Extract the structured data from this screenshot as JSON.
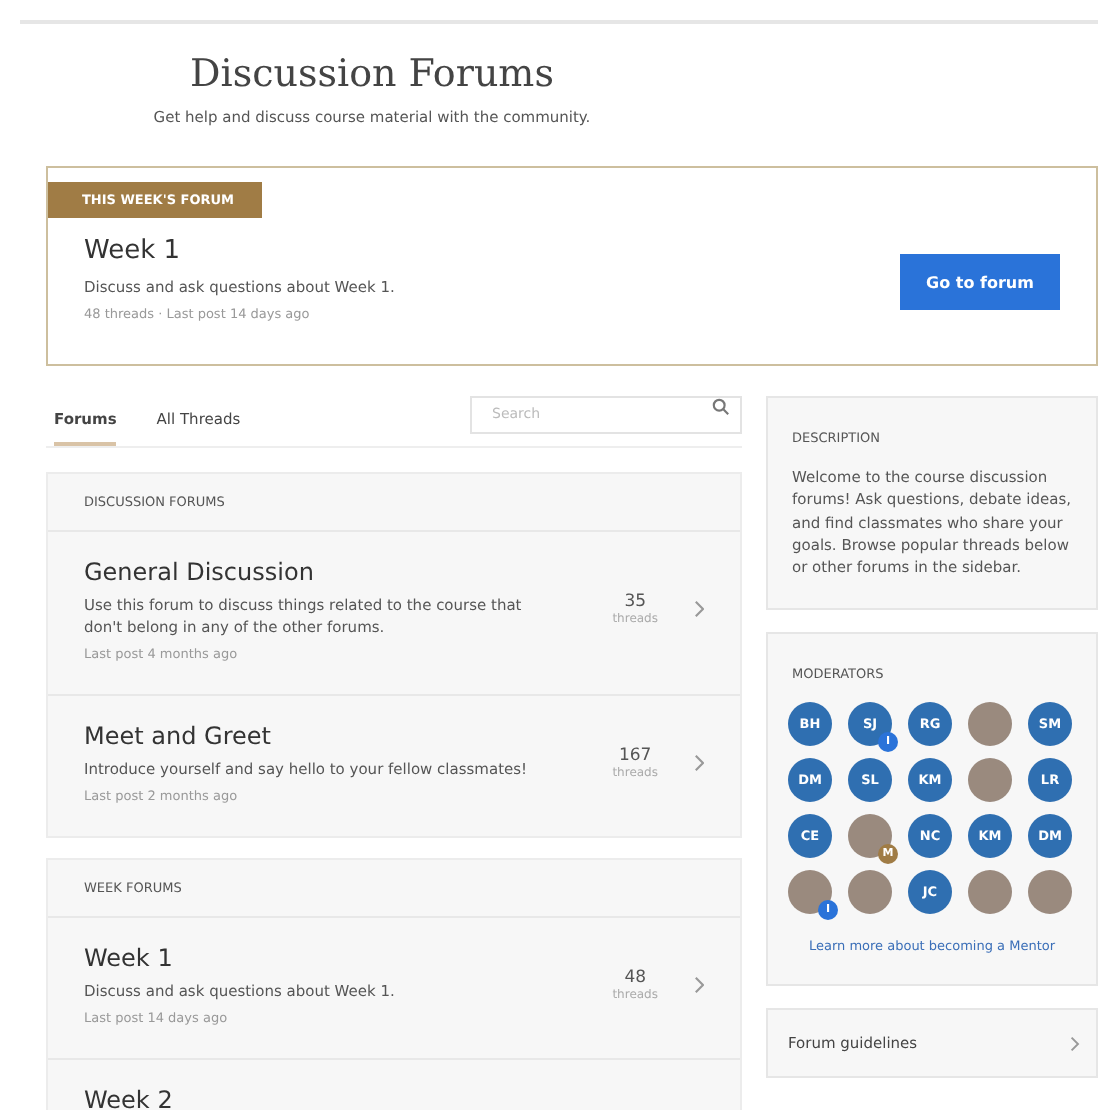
{
  "header": {
    "title": "Discussion Forums",
    "subtitle": "Get help and discuss course material with the community."
  },
  "featured": {
    "badge": "THIS WEEK'S FORUM",
    "title": "Week 1",
    "description": "Discuss and ask questions about Week 1.",
    "meta": "48 threads · Last post 14 days ago",
    "button": "Go to forum"
  },
  "tabs": [
    {
      "label": "Forums",
      "selected": true
    },
    {
      "label": "All Threads",
      "selected": false
    }
  ],
  "search": {
    "placeholder": "Search"
  },
  "sections": [
    {
      "heading": "DISCUSSION FORUMS",
      "forums": [
        {
          "title": "General Discussion",
          "description": "Use this forum to discuss things related to the course that don't belong in any of the other forums.",
          "last_post": "Last post 4 months ago",
          "count": "35",
          "count_label": "threads"
        },
        {
          "title": "Meet and Greet",
          "description": "Introduce yourself and say hello to your fellow classmates!",
          "last_post": "Last post 2 months ago",
          "count": "167",
          "count_label": "threads"
        }
      ]
    },
    {
      "heading": "WEEK FORUMS",
      "forums": [
        {
          "title": "Week 1",
          "description": "Discuss and ask questions about Week 1.",
          "last_post": "Last post 14 days ago",
          "count": "48",
          "count_label": "threads"
        },
        {
          "title": "Week 2"
        }
      ]
    }
  ],
  "description": {
    "heading": "DESCRIPTION",
    "text": "Welcome to the course discussion forums! Ask questions, debate ideas, and find classmates who share your goals. Browse popular threads below or other forums in the sidebar."
  },
  "moderators": {
    "heading": "MODERATORS",
    "people": [
      {
        "kind": "initials",
        "initials": "BH"
      },
      {
        "kind": "initials",
        "initials": "SJ",
        "badge": "I",
        "color": "#2a73d9"
      },
      {
        "kind": "initials",
        "initials": "RG"
      },
      {
        "kind": "photo"
      },
      {
        "kind": "initials",
        "initials": "SM"
      },
      {
        "kind": "initials",
        "initials": "DM"
      },
      {
        "kind": "initials",
        "initials": "SL"
      },
      {
        "kind": "initials",
        "initials": "KM"
      },
      {
        "kind": "photo"
      },
      {
        "kind": "initials",
        "initials": "LR"
      },
      {
        "kind": "initials",
        "initials": "CE"
      },
      {
        "kind": "photo",
        "badge": "M",
        "color": "#a07c45"
      },
      {
        "kind": "initials",
        "initials": "NC"
      },
      {
        "kind": "initials",
        "initials": "KM"
      },
      {
        "kind": "initials",
        "initials": "DM"
      },
      {
        "kind": "photo",
        "badge": "I",
        "color": "#2a73d9"
      },
      {
        "kind": "photo"
      },
      {
        "kind": "initials",
        "initials": "JC"
      },
      {
        "kind": "photo"
      },
      {
        "kind": "photo"
      }
    ],
    "link": "Learn more about becoming a Mentor"
  },
  "guidelines": {
    "label": "Forum guidelines"
  }
}
